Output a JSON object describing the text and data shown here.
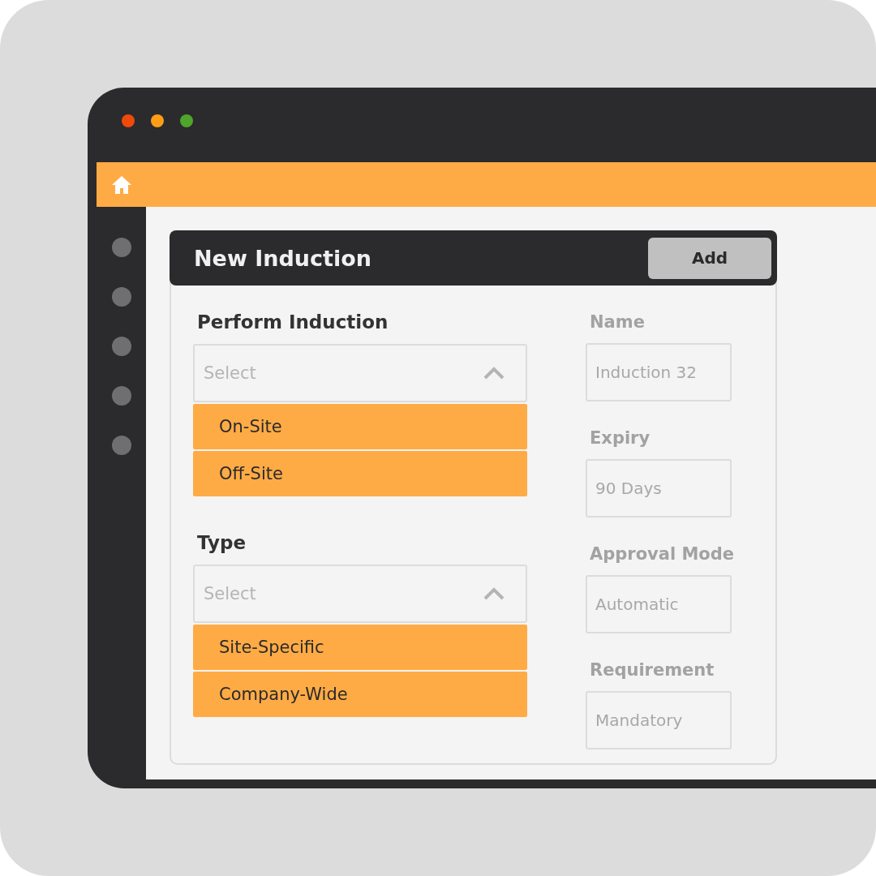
{
  "header": {
    "title": "New Induction",
    "button": "Add"
  },
  "dropdowns": [
    {
      "label": "Perform Induction",
      "placeholder": "Select",
      "expanded": true,
      "options": [
        "On-Site",
        "Off-Site"
      ]
    },
    {
      "label": "Type",
      "placeholder": "Select",
      "expanded": true,
      "options": [
        "Site-Specific",
        "Company-Wide"
      ]
    }
  ],
  "fields": [
    {
      "label": "Name",
      "value": "Induction 32",
      "disabled": true
    },
    {
      "label": "Expiry",
      "value": "90 Days",
      "disabled": true
    },
    {
      "label": "Approval Mode",
      "value": "Automatic",
      "disabled": true
    },
    {
      "label": "Requirement",
      "value": "Mandatory",
      "disabled": true
    }
  ]
}
